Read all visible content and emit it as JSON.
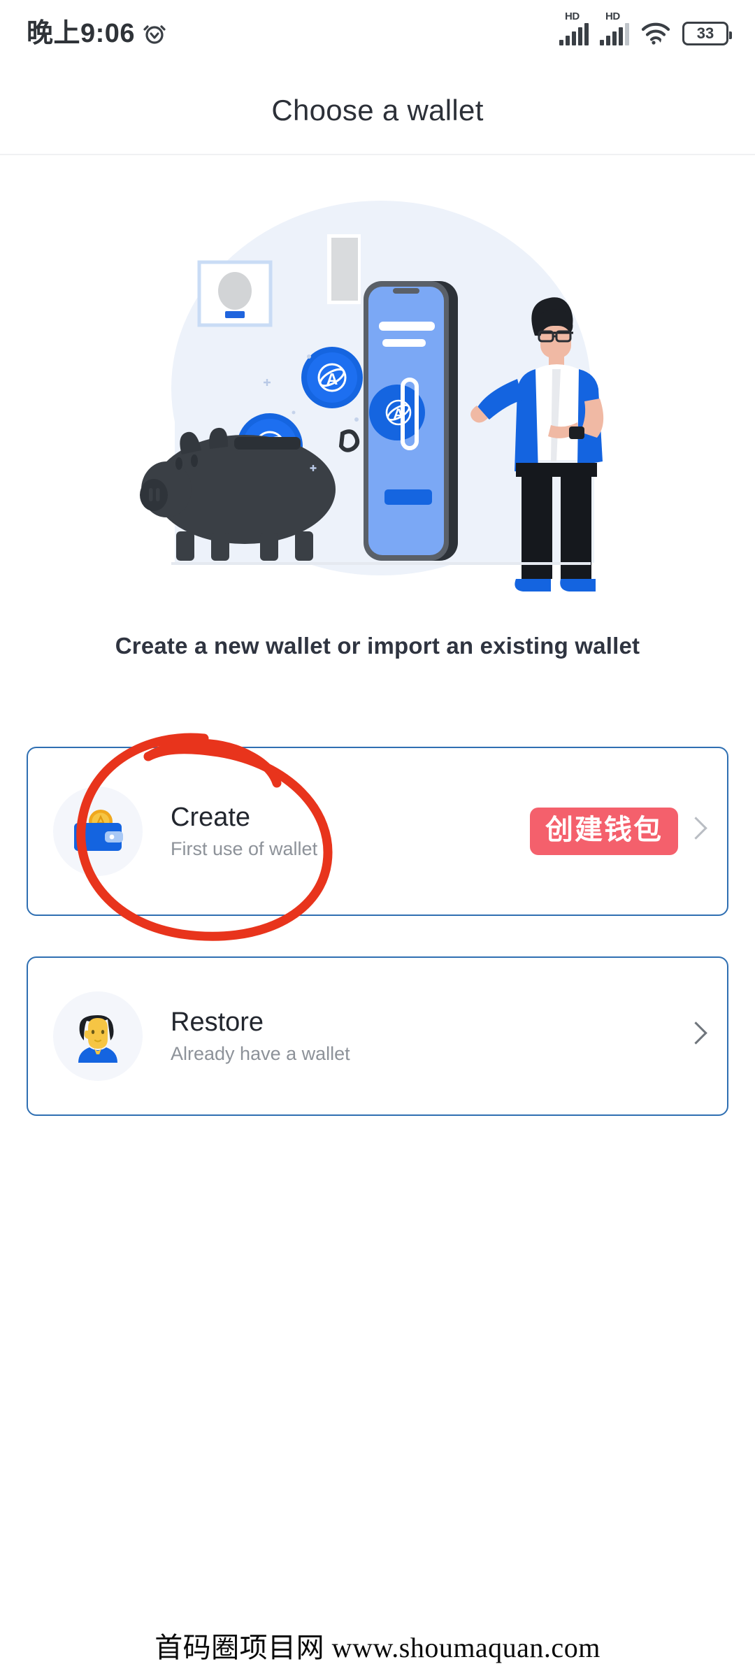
{
  "status_bar": {
    "time": "晚上9:06",
    "alarm_icon": "alarm-clock-icon",
    "signal_1_label": "HD",
    "signal_2_label": "HD",
    "wifi_icon": "wifi-icon",
    "battery_level": "33"
  },
  "header": {
    "title": "Choose a wallet"
  },
  "illustration": {
    "name": "wallet-onboarding-illustration",
    "elements": [
      "piggy-bank",
      "crypto-coins",
      "smartphone",
      "standing-person",
      "framed-picture"
    ],
    "coin_symbol": "A",
    "colors": {
      "backdrop": "#edf2fa",
      "coin_blue": "#1565e0",
      "phone_screen": "#7ba8f5",
      "piggy_dark": "#3a3f45",
      "shirt_blue": "#1464e0"
    }
  },
  "main": {
    "subtitle": "Create a new wallet or import an existing wallet",
    "options": [
      {
        "icon": "wallet-coin-icon",
        "title": "Create",
        "subtitle": "First use of wallet",
        "badge": "创建钱包",
        "chevron": "chevron-right-icon"
      },
      {
        "icon": "person-avatar-icon",
        "title": "Restore",
        "subtitle": "Already have a wallet",
        "badge": "",
        "chevron": "chevron-right-icon"
      }
    ]
  },
  "annotation": {
    "shape": "hand-drawn-red-ellipse",
    "color": "#e8341c",
    "target": "Create"
  },
  "footer": {
    "watermark": "首码圈项目网 www.shoumaquan.com"
  },
  "colors": {
    "card_border": "#2f6fb2",
    "badge_red": "#f4606c",
    "title_dark": "#2c3038",
    "muted_gray": "#8d9299"
  }
}
